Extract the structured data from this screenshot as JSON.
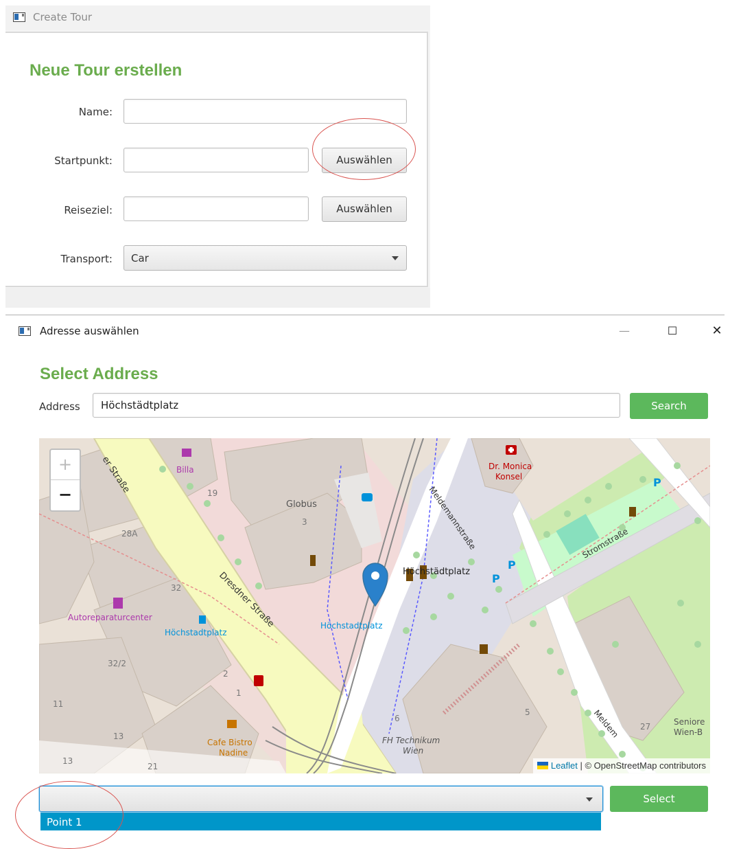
{
  "create_tour_window": {
    "title": "Create Tour",
    "heading": "Neue Tour erstellen",
    "name_label": "Name:",
    "start_label": "Startpunkt:",
    "start_button": "Auswählen",
    "destination_label": "Reiseziel:",
    "destination_button": "Auswählen",
    "transport_label": "Transport:",
    "transport_value": "Car"
  },
  "address_window": {
    "title": "Adresse auswählen",
    "minimize": "—",
    "maximize": "☐",
    "close": "✕",
    "heading": "Select Address",
    "address_label": "Address",
    "address_value": "Höchstädtplatz",
    "search_button": "Search",
    "select_button": "Select",
    "dropdown_items": [
      "Point 1"
    ],
    "map": {
      "zoom_in": "+",
      "zoom_out": "−",
      "attribution_link": "Leaflet",
      "attribution_rest": " | © OpenStreetMap contributors",
      "labels": {
        "dresdner_top": "er Straße",
        "billa": "Billa",
        "num_19": "19",
        "globus": "Globus",
        "num_3": "3",
        "num_28a": "28A",
        "dr_monica_1": "Dr. Monica",
        "dr_monica_2": "Konsel",
        "meldemann": "Meldemannstraße",
        "strom": "Stromstraße",
        "hoechstaedt_platz": "Höchstädtplatz",
        "num_32": "32",
        "autorep": "Autoreparaturcenter",
        "hoechstadt_bus": "Höchstadtplatz",
        "dresdner": "Dresdner Straße",
        "hoechstadt_tram": "Höchstadtplatz",
        "num_32_2": "32/2",
        "num_2": "2",
        "num_1": "1",
        "num_11": "11",
        "num_13a": "13",
        "num_13b": "13",
        "num_21": "21",
        "num_6": "6",
        "num_5": "5",
        "num_27": "27",
        "cafe_1": "Cafe Bistro",
        "cafe_2": "Nadine",
        "fh_1": "FH Technikum",
        "fh_2": "Wien",
        "senior_1": "Seniore",
        "senior_2": "Wien-B",
        "meldem_bottom": "Meldem"
      }
    }
  },
  "colors": {
    "heading_green": "#6aac4d",
    "button_green": "#5cb85c",
    "selection_blue": "#0096c9",
    "annotation_red": "#d9534f",
    "marker_blue": "#2a81cb"
  }
}
